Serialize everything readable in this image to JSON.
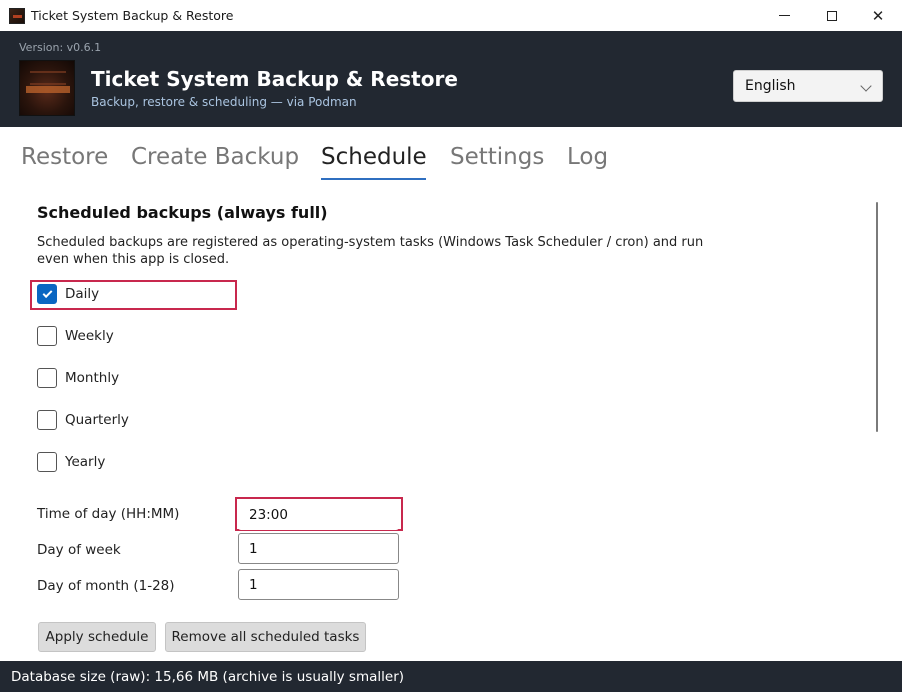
{
  "window": {
    "title": "Ticket System Backup & Restore",
    "controls": {
      "minimize": "minimize",
      "maximize": "maximize",
      "close": "✕"
    }
  },
  "header": {
    "version": "Version: v0.6.1",
    "title": "Ticket System Backup & Restore",
    "subtitle": "Backup, restore & scheduling — via Podman",
    "language": "English"
  },
  "tabs": [
    {
      "label": "Restore",
      "active": false
    },
    {
      "label": "Create Backup",
      "active": false
    },
    {
      "label": "Schedule",
      "active": true
    },
    {
      "label": "Settings",
      "active": false
    },
    {
      "label": "Log",
      "active": false
    }
  ],
  "schedule": {
    "section_title": "Scheduled backups (always full)",
    "description": "Scheduled backups are registered as operating-system tasks (Windows Task Scheduler / cron) and run even when this app is closed.",
    "options": [
      {
        "label": "Daily",
        "checked": true
      },
      {
        "label": "Weekly",
        "checked": false
      },
      {
        "label": "Monthly",
        "checked": false
      },
      {
        "label": "Quarterly",
        "checked": false
      },
      {
        "label": "Yearly",
        "checked": false
      }
    ],
    "fields": {
      "time_of_day": {
        "label": "Time of day (HH:MM)",
        "value": "23:00"
      },
      "day_of_week": {
        "label": "Day of week",
        "value": "1"
      },
      "day_of_month": {
        "label": "Day of month (1-28)",
        "value": "1"
      }
    },
    "apply_button": "Apply schedule",
    "remove_button": "Remove all scheduled tasks"
  },
  "status": {
    "text": "Database size (raw): 15,66 MB (archive is usually smaller)"
  },
  "colors": {
    "header_bg": "#222831",
    "accent": "#0a66c2",
    "highlight": "#c8284d",
    "tab_underline": "#2f6fc0"
  }
}
